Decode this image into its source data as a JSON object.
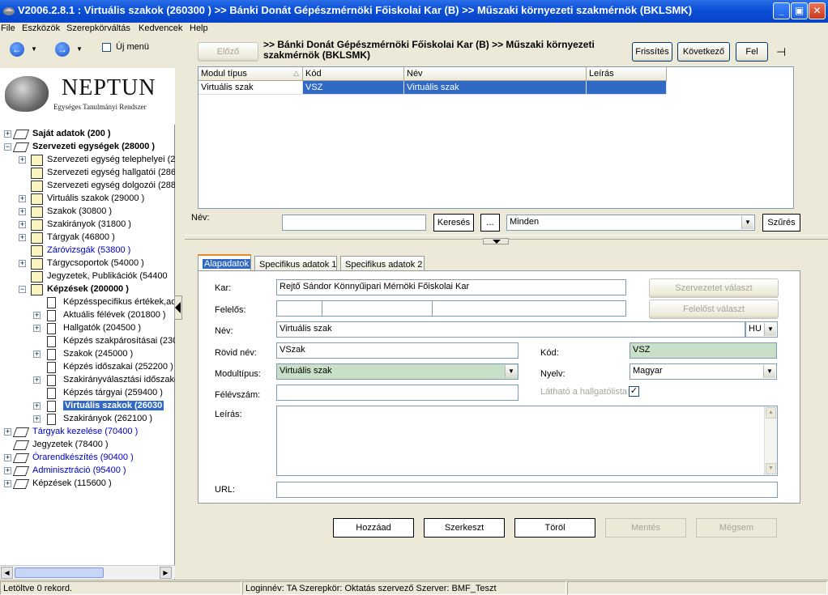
{
  "window": {
    "title": "V2006.2.8.1 : Virtuális szakok (260300  )  >> Bánki Donát Gépészmérnöki Főiskolai Kar (B) >> Műszaki környezeti szakmérnök (BKLSMK)",
    "minimize": "_",
    "maximize": "▣",
    "close": "✕"
  },
  "menu": [
    "File",
    "Eszközök",
    "Szerepkörváltás",
    "Kedvencek",
    "Help"
  ],
  "nav": {
    "ujmenu_label": "Új menü"
  },
  "logo": {
    "title": "NEPTUN",
    "subtitle": "Egységes Tanulmányi Rendszer"
  },
  "tree": [
    {
      "label": "Saját adatok (200  )",
      "level": 0,
      "exp": "+",
      "icon": "book",
      "bold": true
    },
    {
      "label": "Szervezeti egységek (28000  )",
      "level": 0,
      "exp": "−",
      "icon": "book",
      "bold": true
    },
    {
      "label": "Szervezeti egység telephelyei (2",
      "level": 1,
      "exp": "+",
      "icon": "folder"
    },
    {
      "label": "Szervezeti egység hallgatói (286",
      "level": 1,
      "exp": "",
      "icon": "folder"
    },
    {
      "label": "Szervezeti egység dolgozói (288",
      "level": 1,
      "exp": "",
      "icon": "folder"
    },
    {
      "label": "Virtuális szakok (29000  )",
      "level": 1,
      "exp": "+",
      "icon": "folder"
    },
    {
      "label": "Szakok (30800  )",
      "level": 1,
      "exp": "+",
      "icon": "folder"
    },
    {
      "label": "Szakirányok (31800  )",
      "level": 1,
      "exp": "+",
      "icon": "folder"
    },
    {
      "label": "Tárgyak (46800  )",
      "level": 1,
      "exp": "+",
      "icon": "folder"
    },
    {
      "label": "Záróvizsgák (53800  )",
      "level": 1,
      "exp": "",
      "icon": "folder",
      "blue": true
    },
    {
      "label": "Tárgycsoportok (54000  )",
      "level": 1,
      "exp": "+",
      "icon": "folder"
    },
    {
      "label": "Jegyzetek, Publikációk (54400",
      "level": 1,
      "exp": "",
      "icon": "folder"
    },
    {
      "label": "Képzések (200000  )",
      "level": 1,
      "exp": "−",
      "icon": "folder",
      "bold": true
    },
    {
      "label": "Képzésspecifikus értékek,ad",
      "level": 2,
      "exp": "",
      "icon": "doc"
    },
    {
      "label": "Aktuális félévek (201800  )",
      "level": 2,
      "exp": "+",
      "icon": "doc"
    },
    {
      "label": "Hallgatók (204500  )",
      "level": 2,
      "exp": "+",
      "icon": "doc"
    },
    {
      "label": "Képzés szakpárosításai (230",
      "level": 2,
      "exp": "",
      "icon": "doc"
    },
    {
      "label": "Szakok (245000  )",
      "level": 2,
      "exp": "+",
      "icon": "doc"
    },
    {
      "label": "Képzés időszakai (252200  )",
      "level": 2,
      "exp": "",
      "icon": "doc"
    },
    {
      "label": "Szakirányválasztási időszako",
      "level": 2,
      "exp": "+",
      "icon": "doc"
    },
    {
      "label": "Képzés tárgyai (259400  )",
      "level": 2,
      "exp": "",
      "icon": "doc"
    },
    {
      "label": "Virtuális szakok (26030",
      "level": 2,
      "exp": "+",
      "icon": "doc",
      "bold": true,
      "selected": true
    },
    {
      "label": "Szakirányok (262100  )",
      "level": 2,
      "exp": "+",
      "icon": "doc"
    },
    {
      "label": "Tárgyak kezelése (70400  )",
      "level": 0,
      "exp": "+",
      "icon": "book",
      "blue": true
    },
    {
      "label": "Jegyzetek (78400  )",
      "level": 0,
      "exp": "",
      "icon": "book"
    },
    {
      "label": "Órarendkészítés (90400  )",
      "level": 0,
      "exp": "+",
      "icon": "book",
      "blue": true
    },
    {
      "label": "Adminisztráció (95400  )",
      "level": 0,
      "exp": "+",
      "icon": "book",
      "blue": true
    },
    {
      "label": "Képzések (115600  )",
      "level": 0,
      "exp": "+",
      "icon": "book"
    }
  ],
  "top": {
    "prev": "Előző",
    "breadcrumb": ">> Bánki Donát Gépészmérnöki Főiskolai Kar (B) >> Műszaki környezeti szakmérnök (BKLSMK)",
    "refresh": "Frissítés",
    "next": "Következő",
    "up": "Fel",
    "pin": "⊣"
  },
  "grid": {
    "columns": [
      "Modul típus",
      "Kód",
      "Név",
      "Leírás"
    ],
    "sort_indicator": "△",
    "rows": [
      [
        "Virtuális szak",
        "VSZ",
        "Virtuális szak",
        ""
      ]
    ]
  },
  "filter": {
    "label": "Név:",
    "value": "",
    "search": "Keresés",
    "ellipsis": "...",
    "scope": "Minden",
    "apply": "Szűrés"
  },
  "tabs": [
    "Alapadatok",
    "Specifikus adatok 1",
    "Specifikus adatok 2"
  ],
  "form": {
    "kar_label": "Kar:",
    "kar_value": "Rejtő Sándor Könnyűipari Mérnöki Főiskolai Kar",
    "szervezet_btn": "Szervezetet választ",
    "felelos_label": "Felelős:",
    "felelos_btn": "Felelőst választ",
    "nev_label": "Név:",
    "nev_value": "Virtuális szak",
    "lang": "HU",
    "rovidnev_label": "Rövid név:",
    "rovidnev_value": "VSzak",
    "kod_label": "Kód:",
    "kod_value": "VSZ",
    "modultipus_label": "Modultípus:",
    "modultipus_value": "Virtuális szak",
    "nyelv_label": "Nyelv:",
    "nyelv_value": "Magyar",
    "felevszam_label": "Félévszám:",
    "felevszam_value": "",
    "lathato_label": "Látható a hallgatólista",
    "lathato_checked": "✓",
    "leiras_label": "Leírás:",
    "leiras_value": "",
    "url_label": "URL:",
    "url_value": ""
  },
  "actions": {
    "add": "Hozzáad",
    "edit": "Szerkeszt",
    "delete": "Töröl",
    "save": "Mentés",
    "cancel": "Mégsem"
  },
  "status": {
    "records": "Letöltve 0 rekord.",
    "session": "Loginnév: TA   Szerepkör: Oktatás szervező   Szerver: BMF_Teszt"
  }
}
